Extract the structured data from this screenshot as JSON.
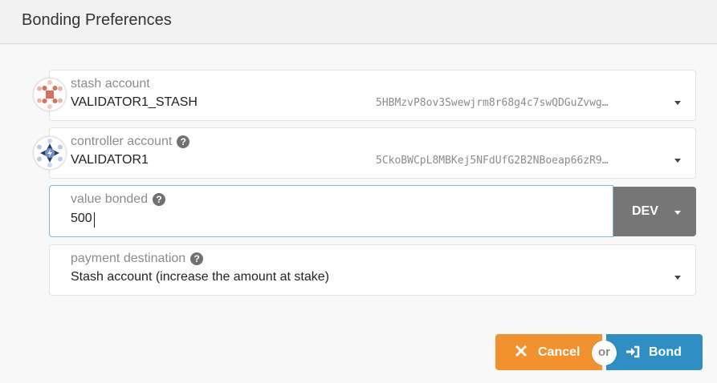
{
  "modal": {
    "title": "Bonding Preferences"
  },
  "stash": {
    "label": "stash account",
    "name": "VALIDATOR1_STASH",
    "address": "5HBMzvP8ov3Swewjrm8r68g4c7swQDGuZvwg…",
    "icon": "identicon"
  },
  "controller": {
    "label": "controller account",
    "name": "VALIDATOR1",
    "address": "5CkoBWCpL8MBKej5NFdUfG2B2NBoeap66zR9…",
    "icon": "identicon"
  },
  "bonded": {
    "label": "value bonded",
    "value": "500",
    "unit": "DEV"
  },
  "payment": {
    "label": "payment destination",
    "value": "Stash account (increase the amount at stake)"
  },
  "actions": {
    "cancel_label": "Cancel",
    "or_label": "or",
    "bond_label": "Bond"
  },
  "colors": {
    "cancel": "#f2922e",
    "bond": "#2f8fc4",
    "unit_dropdown": "#767676",
    "focus_border": "#85b7d9"
  }
}
